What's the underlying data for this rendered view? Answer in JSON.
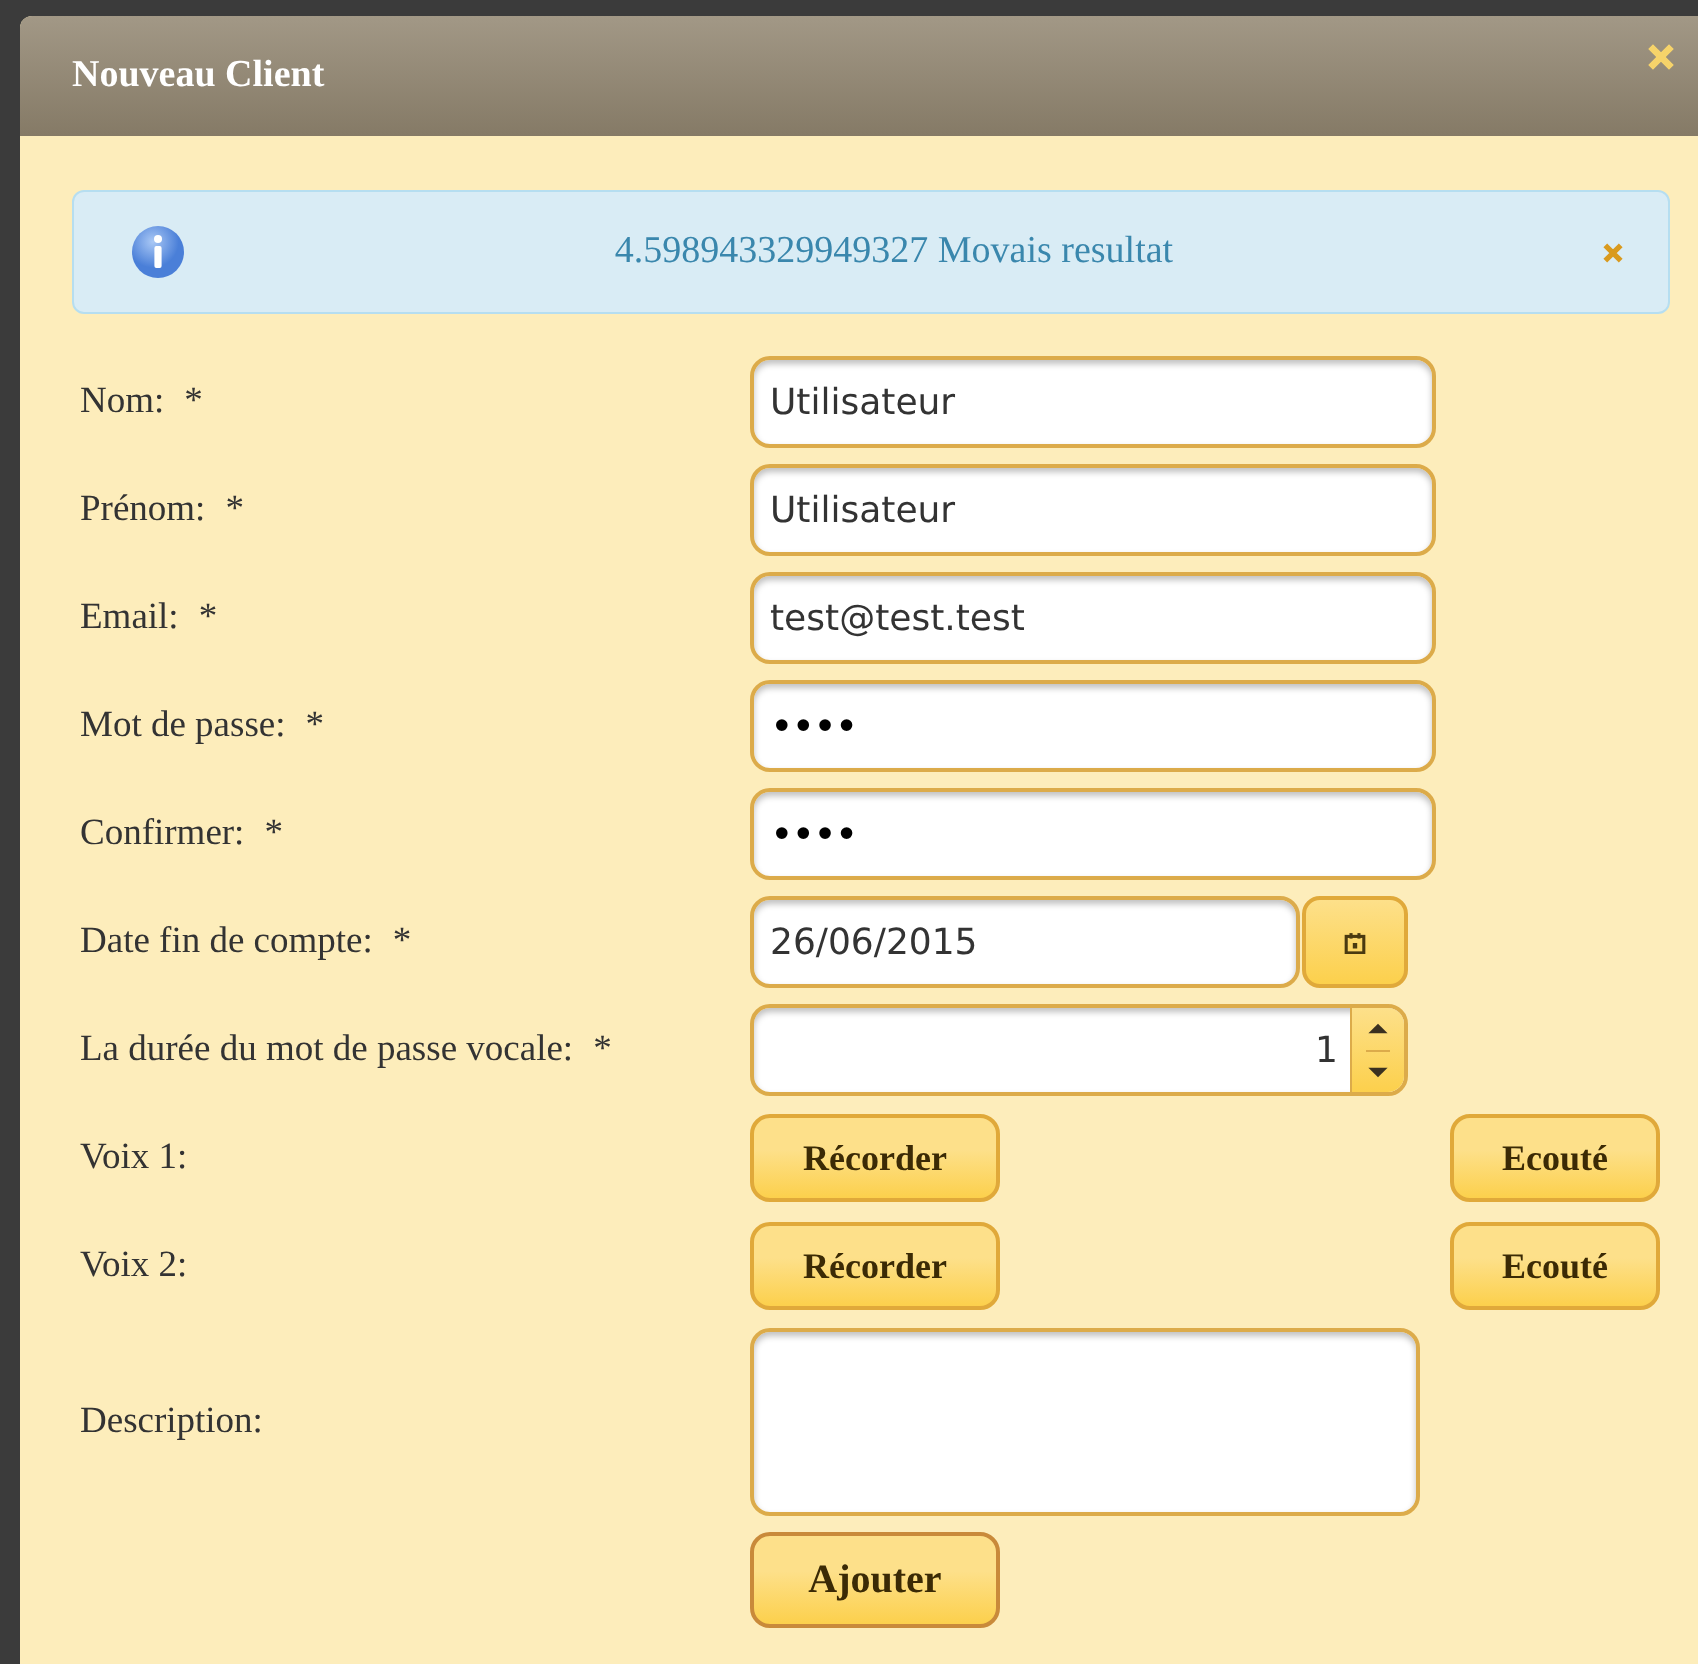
{
  "window": {
    "title": "Nouveau Client"
  },
  "message": {
    "text": "4.598943329949327 Movais resultat"
  },
  "fields": [
    {
      "kind": "text",
      "label": "Nom:",
      "mark": "*",
      "value": "Utilisateur"
    },
    {
      "kind": "text",
      "label": "Prénom:",
      "mark": "*",
      "value": "Utilisateur"
    },
    {
      "kind": "text",
      "label": "Email:",
      "mark": "*",
      "value": "test@test.test"
    },
    {
      "kind": "password",
      "label": "Mot de passe:",
      "mark": "*",
      "value": "••••"
    },
    {
      "kind": "password",
      "label": "Confirmer:",
      "mark": "*",
      "value": "••••"
    },
    {
      "kind": "date",
      "label": "Date fin de compte:",
      "mark": "*",
      "value": "26/06/2015"
    },
    {
      "kind": "spinner",
      "label": "La durée du mot de passe vocale:",
      "mark": "*",
      "value": "1"
    },
    {
      "kind": "voice",
      "label": "Voix 1:",
      "record": "Récorder",
      "play": "Ecouté"
    },
    {
      "kind": "voice",
      "label": "Voix 2:",
      "record": "Récorder",
      "play": "Ecouté"
    },
    {
      "kind": "textarea",
      "label": "Description:"
    }
  ],
  "submit": "Ajouter"
}
